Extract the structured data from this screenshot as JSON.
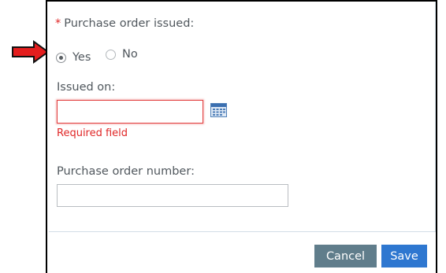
{
  "left_snippet": {
    "line1": "",
    "line2": "",
    "line3": ""
  },
  "form": {
    "purchase_order_issued": {
      "required_marker": "*",
      "label": "Purchase order issued:",
      "options": [
        {
          "label": "Yes",
          "checked": true
        },
        {
          "label": "No",
          "checked": false
        }
      ]
    },
    "issued_on": {
      "label": "Issued on:",
      "value": "",
      "error": "Required field",
      "icon": "calendar-icon"
    },
    "purchase_order_number": {
      "label": "Purchase order number:",
      "value": ""
    }
  },
  "actions": {
    "cancel_label": "Cancel",
    "save_label": "Save"
  },
  "colors": {
    "required": "#e02727",
    "label_text": "#50575d",
    "cancel_bg": "#607d8b",
    "save_bg": "#2e77d0",
    "annotation_arrow": "#e41e1e"
  }
}
